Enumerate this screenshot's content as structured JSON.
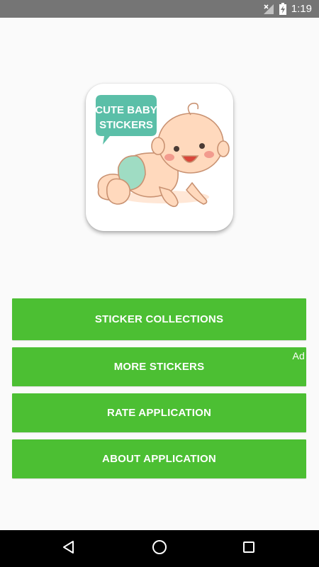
{
  "status_bar": {
    "time": "1:19",
    "icons": [
      "signal-off-icon",
      "battery-charging-icon"
    ]
  },
  "app_icon": {
    "banner_line1": "CUTE BABY",
    "banner_line2": "STICKERS",
    "colors": {
      "banner": "#5bbfa8",
      "skin": "#ffd9bd",
      "diaper": "#9fdcc3",
      "cheek": "#f29b8e"
    }
  },
  "menu": {
    "sticker_collections": "STICKER COLLECTIONS",
    "more_stickers": "MORE STICKERS",
    "ad_badge": "Ad",
    "rate_application": "RATE APPLICATION",
    "about_application": "ABOUT APPLICATION"
  },
  "nav_bar": {
    "icons": [
      "back-icon",
      "home-icon",
      "recents-icon"
    ]
  },
  "colors": {
    "button": "#4cbf33",
    "status_bar": "#757575",
    "background": "#fafafa"
  }
}
